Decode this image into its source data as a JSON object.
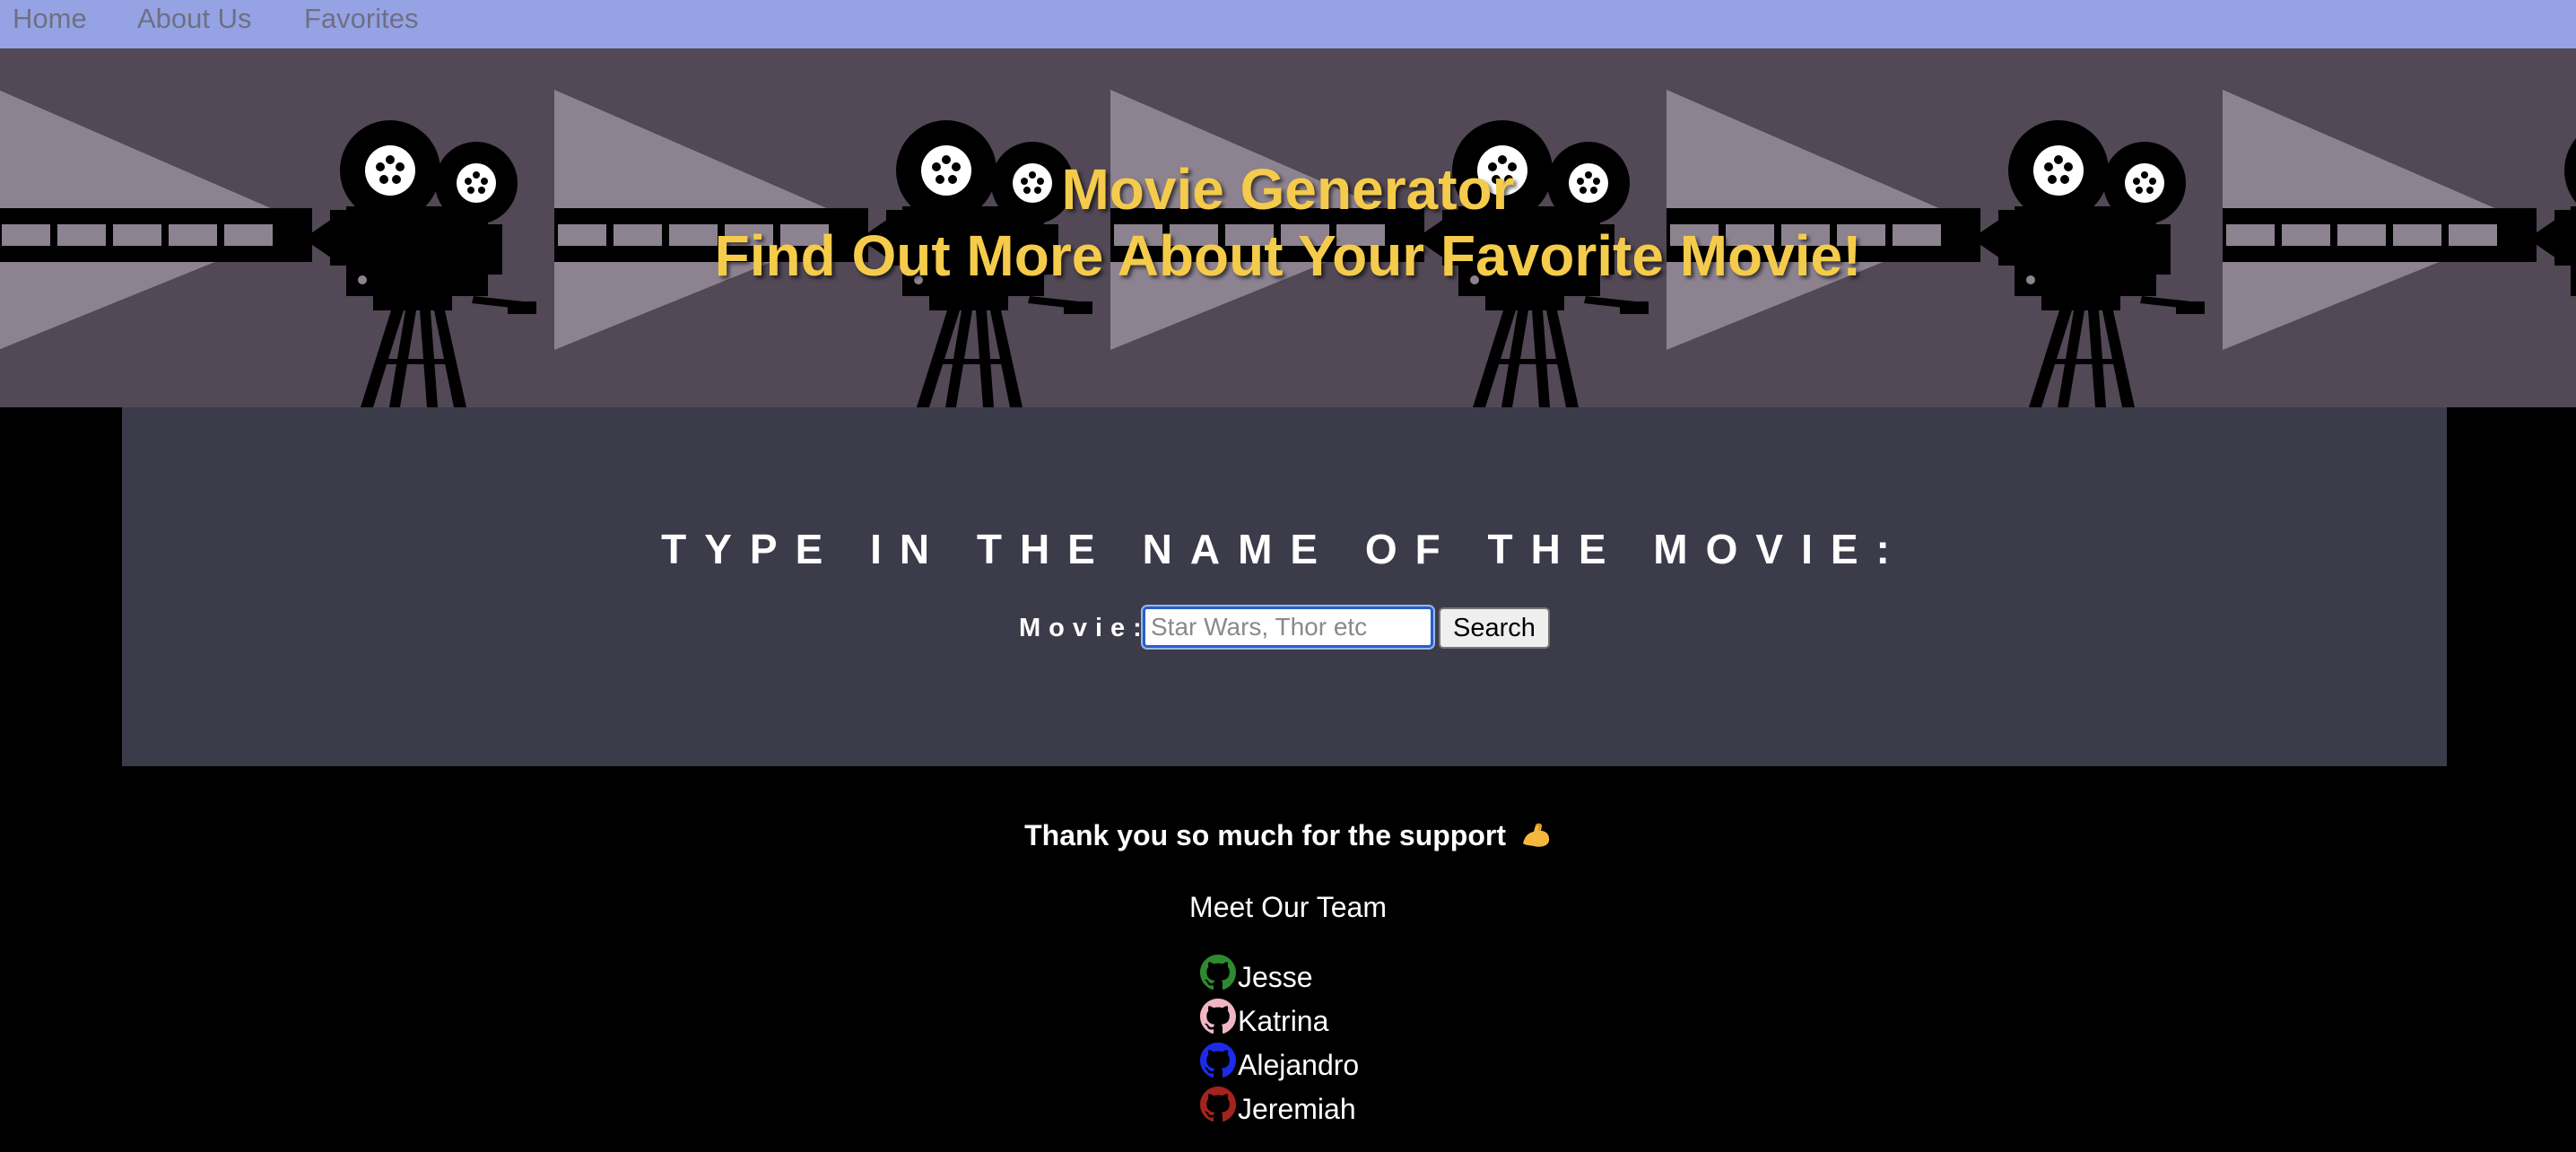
{
  "nav": {
    "items": [
      {
        "label": "Home"
      },
      {
        "label": "About Us"
      },
      {
        "label": "Favorites"
      }
    ]
  },
  "hero": {
    "title": "Movie Generator",
    "subtitle": "Find Out More About Your Favorite Movie!",
    "background_color": "#524856",
    "text_color": "#f5cb4c"
  },
  "search": {
    "heading": "TYPE IN THE NAME OF THE MOVIE:",
    "label": "Movie:",
    "input_value": "",
    "placeholder": "Star Wars, Thor etc",
    "button_label": "Search"
  },
  "footer": {
    "thanks": "Thank you so much for the support",
    "thanks_icon": "flexed-biceps-emoji",
    "meet_team": "Meet Our Team",
    "team": [
      {
        "name": "Jesse",
        "icon": "github-icon",
        "color": "#2f8a2f"
      },
      {
        "name": "Katrina",
        "icon": "github-icon",
        "color": "#f1b6c4"
      },
      {
        "name": "Alejandro",
        "icon": "github-icon",
        "color": "#1c2be8"
      },
      {
        "name": "Jeremiah",
        "icon": "github-icon",
        "color": "#a3231d"
      }
    ]
  }
}
